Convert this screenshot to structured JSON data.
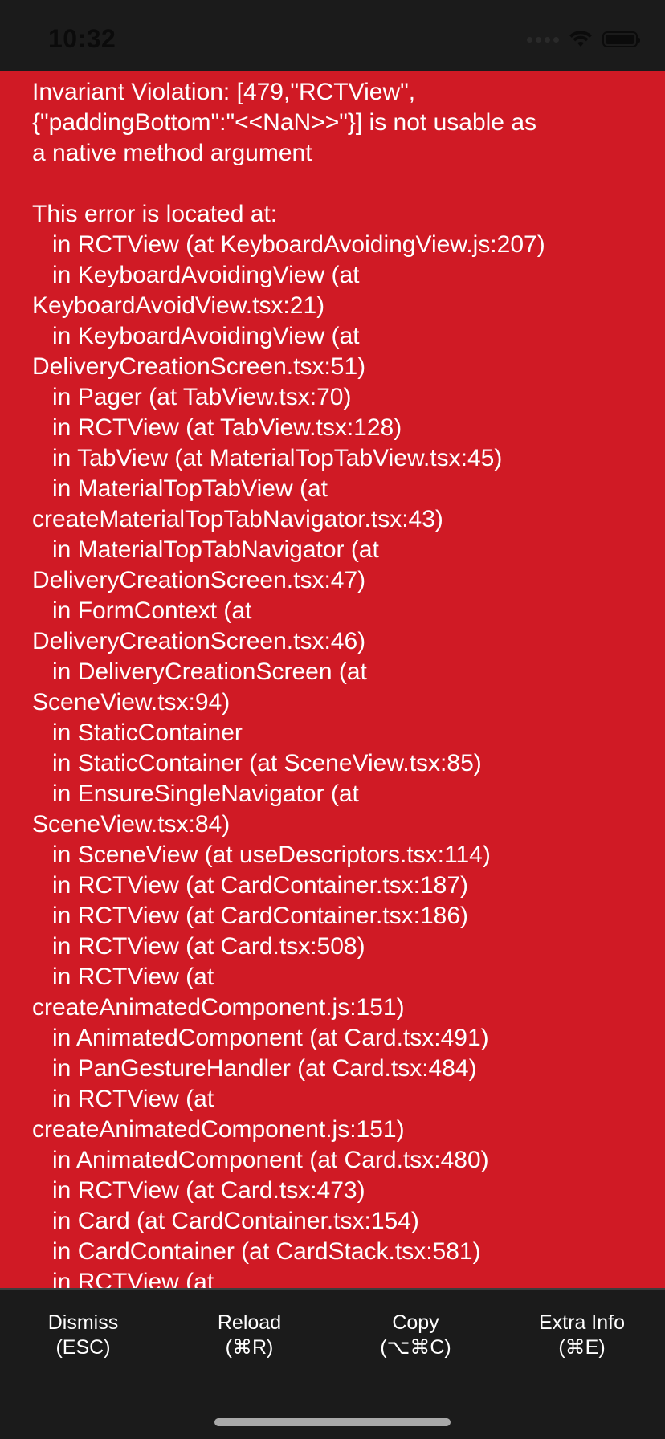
{
  "status_bar": {
    "time": "10:32"
  },
  "error": {
    "message": "Invariant Violation: [479,\"RCTView\",\n{\"paddingBottom\":\"<<NaN>>\"}] is not usable as\na native method argument",
    "stack_header": "This error is located at:",
    "stack_lines": [
      "   in RCTView (at KeyboardAvoidingView.js:207)",
      "   in KeyboardAvoidingView (at",
      "KeyboardAvoidView.tsx:21)",
      "   in KeyboardAvoidingView (at",
      "DeliveryCreationScreen.tsx:51)",
      "   in Pager (at TabView.tsx:70)",
      "   in RCTView (at TabView.tsx:128)",
      "   in TabView (at MaterialTopTabView.tsx:45)",
      "   in MaterialTopTabView (at",
      "createMaterialTopTabNavigator.tsx:43)",
      "   in MaterialTopTabNavigator (at",
      "DeliveryCreationScreen.tsx:47)",
      "   in FormContext (at",
      "DeliveryCreationScreen.tsx:46)",
      "   in DeliveryCreationScreen (at",
      "SceneView.tsx:94)",
      "   in StaticContainer",
      "   in StaticContainer (at SceneView.tsx:85)",
      "   in EnsureSingleNavigator (at",
      "SceneView.tsx:84)",
      "   in SceneView (at useDescriptors.tsx:114)",
      "   in RCTView (at CardContainer.tsx:187)",
      "   in RCTView (at CardContainer.tsx:186)",
      "   in RCTView (at Card.tsx:508)",
      "   in RCTView (at",
      "createAnimatedComponent.js:151)",
      "   in AnimatedComponent (at Card.tsx:491)",
      "   in PanGestureHandler (at Card.tsx:484)",
      "   in RCTView (at",
      "createAnimatedComponent.js:151)",
      "   in AnimatedComponent (at Card.tsx:480)",
      "   in RCTView (at Card.tsx:473)",
      "   in Card (at CardContainer.tsx:154)",
      "   in CardContainer (at CardStack.tsx:581)",
      "   in RCTView (at"
    ]
  },
  "actions": {
    "dismiss": {
      "label": "Dismiss",
      "shortcut": "(ESC)"
    },
    "reload": {
      "label": "Reload",
      "shortcut": "(⌘R)"
    },
    "copy": {
      "label": "Copy",
      "shortcut": "(⌥⌘C)"
    },
    "extra_info": {
      "label": "Extra Info",
      "shortcut": "(⌘E)"
    }
  },
  "colors": {
    "error_background": "#d01a25",
    "bar_background": "#1b1b1b",
    "text": "#ffffff"
  }
}
